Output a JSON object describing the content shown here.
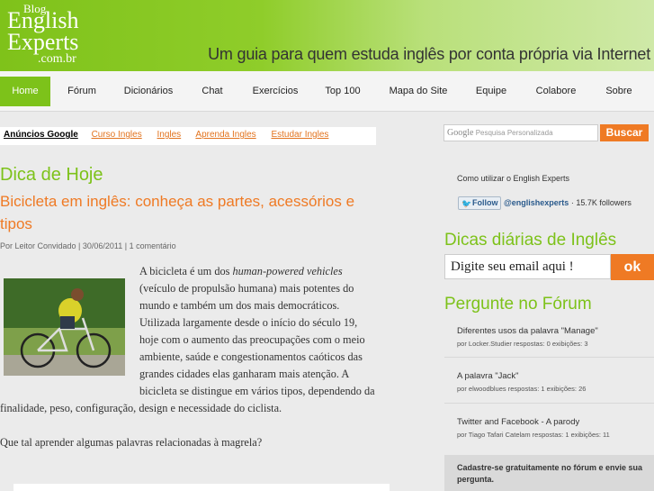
{
  "header": {
    "logo": {
      "line0": "Blog",
      "line1": "English",
      "line2": "Experts",
      "line3": ".com.br"
    },
    "tagline": "Um guia para quem estuda inglês por conta própria via Internet"
  },
  "nav": {
    "items": [
      {
        "label": "Home",
        "active": true
      },
      {
        "label": "Fórum"
      },
      {
        "label": "Dicionários"
      },
      {
        "label": "Chat"
      },
      {
        "label": "Exercícios"
      },
      {
        "label": "Top 100"
      },
      {
        "label": "Mapa do Site"
      },
      {
        "label": "Equipe"
      },
      {
        "label": "Colabore"
      },
      {
        "label": "Sobre"
      }
    ]
  },
  "ads": {
    "label": "Anúncios Google",
    "links": [
      "Curso Ingles",
      "Ingles",
      "Aprenda Ingles",
      "Estudar Ingles"
    ]
  },
  "search": {
    "google_text": "Google",
    "placeholder": "Pesquisa Personalizada",
    "button": "Buscar"
  },
  "main": {
    "section_title": "Dica de Hoje",
    "post_title": "Bicicleta em inglês: conheça as partes, acessórios e tipos",
    "post_meta": "Por Leitor Convidado | 30/06/2011 | 1 comentário",
    "body_intro": "A bicicleta é um dos",
    "body_italic": "human-powered vehicles",
    "body_lines": [
      "(veículo de propulsão humana) mais potentes do",
      "mundo e também um dos mais democráticos.",
      "Utilizada largamente desde o início do século 19,",
      "hoje com o aumento das preocupações com o meio",
      "ambiente, saúde e congestionamentos caóticos das",
      "grandes cidades elas ganharam mais atenção. A",
      "bicicleta se distingue em vários tipos, dependendo da"
    ],
    "body_last": "finalidade, peso, configuração, design e necessidade do ciclista.",
    "question": "Que tal aprender algumas palavras relacionadas à magrela?"
  },
  "sidebar": {
    "how_to": "Como utilizar o English Experts",
    "follow_label": "Follow",
    "follow_handle": "@englishexperts",
    "follow_count": "· 15.7K followers",
    "daily_title": "Dicas diárias de Inglês",
    "email_placeholder": "Digite seu email aqui !",
    "email_button": "ok",
    "forum_title": "Pergunte no Fórum",
    "forum_items": [
      {
        "title": "Diferentes usos da palavra \"Manage\"",
        "meta": "por Locker.Studier   respostas: 0   exibições: 3"
      },
      {
        "title": "A palavra \"Jack\"",
        "meta": "por elwoodblues   respostas: 1   exibições: 26"
      },
      {
        "title": "Twitter and Facebook - A parody",
        "meta": "por Tiago Tafari Catelam   respostas: 1   exibições: 11"
      }
    ],
    "cta": "Cadastre-se gratuitamente no fórum e envie sua pergunta."
  },
  "colors": {
    "brand_green": "#7dc21a",
    "accent_orange": "#ef7a24"
  }
}
